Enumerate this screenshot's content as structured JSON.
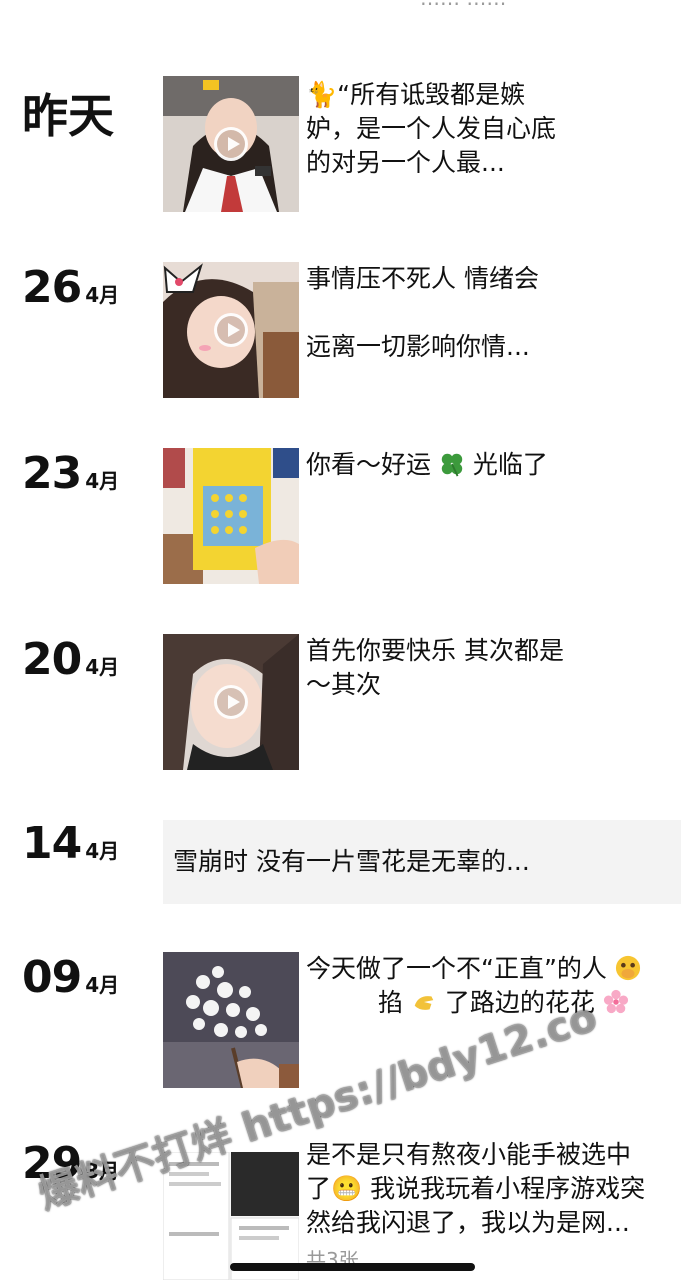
{
  "top_fragment": "…… ……",
  "moments": [
    {
      "date_word": "昨天",
      "caption": "🐈“所有诋毁都是嫉妒，是一个人发自心底的对另一个人最...",
      "media": "video"
    },
    {
      "day": "26",
      "month": "4月",
      "caption_line1": "事情压不死人  情绪会",
      "caption_line2": "远离一切影响你情...",
      "media": "video"
    },
    {
      "day": "23",
      "month": "4月",
      "caption_before": "你看～好运",
      "caption_after": "光临了",
      "emoji": "clover",
      "media": "photo"
    },
    {
      "day": "20",
      "month": "4月",
      "caption": "首先你要快乐  其次都是～其次",
      "media": "video"
    },
    {
      "day": "14",
      "month": "4月",
      "caption": "雪崩时 没有一片雪花是无辜的...",
      "media": "text"
    },
    {
      "day": "09",
      "month": "4月",
      "caption_line1": "今天做了一个不“正直”的人",
      "caption_line2_before": "掐",
      "caption_line2_after": "了路边的花花",
      "media": "photo"
    },
    {
      "day": "29",
      "month": "3月",
      "caption_line1": "是不是只有熬夜小能手被选中",
      "caption_line2": "了😬 我说我玩着小程序游戏突",
      "caption_line3": "然给我闪退了，我以为是网...",
      "image_count": "共3张",
      "media": "multi-photo"
    }
  ],
  "watermark": "爆料不打烊 https://bdy12.co",
  "colors": {
    "background": "#ffffff",
    "text": "#111111",
    "textbox": "#f3f3f3"
  }
}
